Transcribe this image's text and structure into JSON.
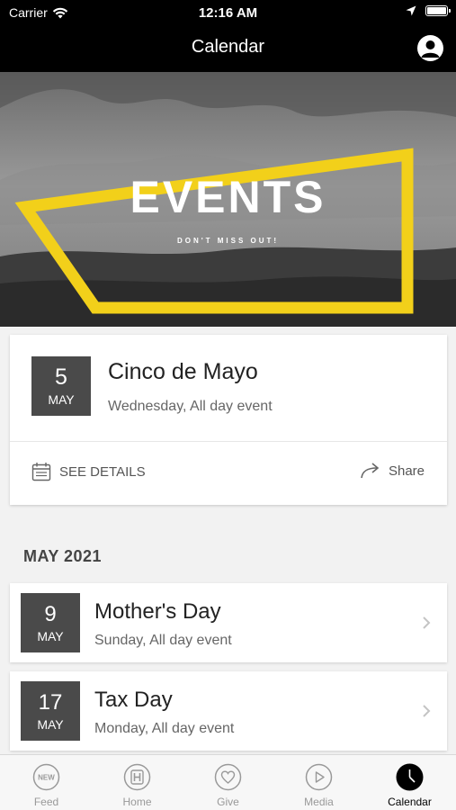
{
  "status_bar": {
    "carrier": "Carrier",
    "time": "12:16 AM"
  },
  "nav": {
    "title": "Calendar"
  },
  "hero": {
    "title": "EVENTS",
    "subtitle": "DON'T MISS OUT!",
    "frame_color": "#f2d01a"
  },
  "featured": {
    "day": "5",
    "month": "MAY",
    "title": "Cinco de Mayo",
    "subtitle": "Wednesday, All day event",
    "details_label": "SEE DETAILS",
    "share_label": "Share"
  },
  "section": {
    "title": "MAY 2021"
  },
  "events": [
    {
      "day": "9",
      "month": "MAY",
      "title": "Mother's Day",
      "subtitle": "Sunday, All day event"
    },
    {
      "day": "17",
      "month": "MAY",
      "title": "Tax Day",
      "subtitle": "Monday, All day event"
    }
  ],
  "tabs": [
    {
      "label": "Feed",
      "icon": "new-badge-icon",
      "active": false
    },
    {
      "label": "Home",
      "icon": "home-h-icon",
      "active": false
    },
    {
      "label": "Give",
      "icon": "heart-icon",
      "active": false
    },
    {
      "label": "Media",
      "icon": "play-icon",
      "active": false
    },
    {
      "label": "Calendar",
      "icon": "clock-icon",
      "active": true
    }
  ]
}
